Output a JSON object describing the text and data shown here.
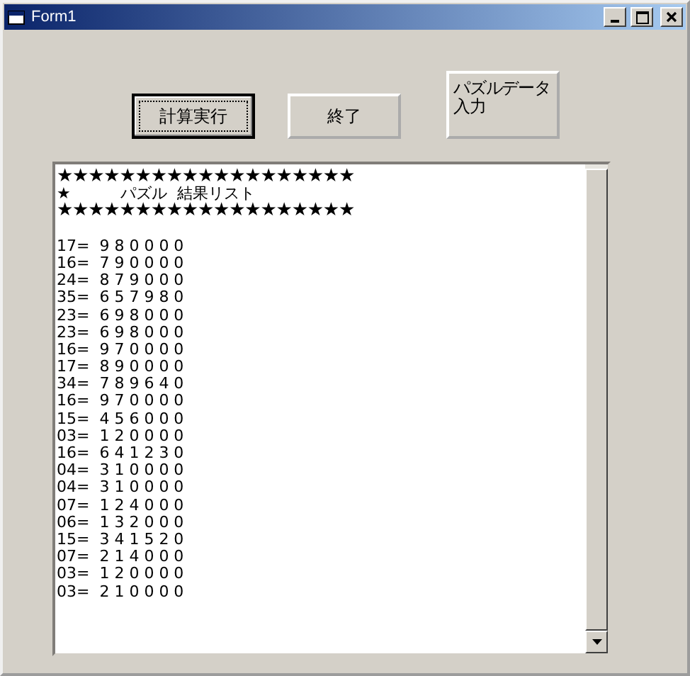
{
  "window": {
    "title": "Form1"
  },
  "buttons": [
    {
      "label": "計算実行",
      "default": true
    },
    {
      "label": "終了",
      "default": false
    },
    {
      "label": "パズルデータ入力",
      "default": false
    }
  ],
  "result_box": {
    "header": [
      "★★★★★★★★★★★★★★★★★★★",
      "★          パズル  結果リスト",
      "★★★★★★★★★★★★★★★★★★★"
    ],
    "lines": [
      "17=  9 8 0 0 0 0",
      "16=  7 9 0 0 0 0",
      "24=  8 7 9 0 0 0",
      "35=  6 5 7 9 8 0",
      "23=  6 9 8 0 0 0",
      "23=  6 9 8 0 0 0",
      "16=  9 7 0 0 0 0",
      "17=  8 9 0 0 0 0",
      "34=  7 8 9 6 4 0",
      "16=  9 7 0 0 0 0",
      "15=  4 5 6 0 0 0",
      "03=  1 2 0 0 0 0",
      "16=  6 4 1 2 3 0",
      "04=  3 1 0 0 0 0",
      "04=  3 1 0 0 0 0",
      "07=  1 2 4 0 0 0",
      "06=  1 3 2 0 0 0",
      "15=  3 4 1 5 2 0",
      "07=  2 1 4 0 0 0",
      "03=  1 2 0 0 0 0",
      "03=  2 1 0 0 0 0"
    ]
  }
}
